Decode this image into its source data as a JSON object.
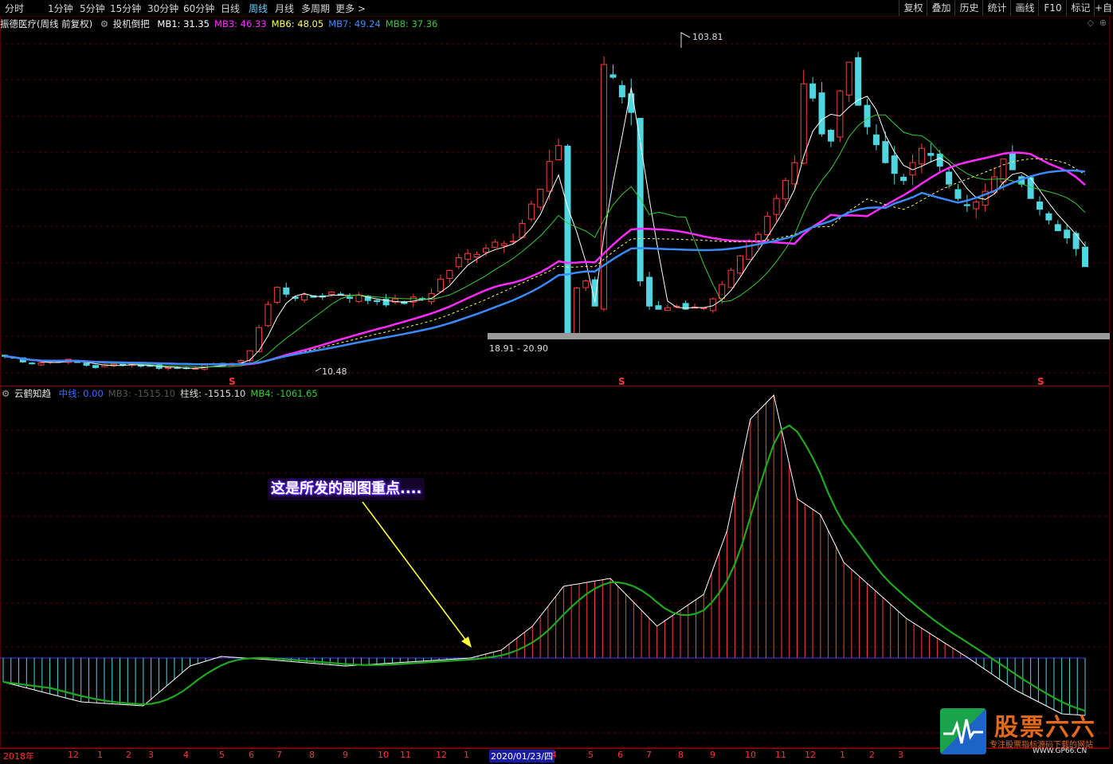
{
  "toolbar": {
    "periods": [
      "分时",
      "1分钟",
      "5分钟",
      "15分钟",
      "30分钟",
      "60分钟",
      "日线",
      "周线",
      "月线",
      "多周期",
      "更多 >"
    ],
    "active_period": "周线",
    "right_buttons": [
      "复权",
      "叠加",
      "历史",
      "统计",
      "画线",
      "F10",
      "标记",
      "+自选"
    ]
  },
  "main_panel": {
    "stock_title": "振德医疗(周线 前复权)",
    "indicator_name": "投机倒把",
    "lines": [
      {
        "label": "MB1: 31.35",
        "color": "#ffffff"
      },
      {
        "label": "MB3: 46.33",
        "color": "#ff2bff"
      },
      {
        "label": "MB6: 48.05",
        "color": "#ffff55"
      },
      {
        "label": "MB7: 49.24",
        "color": "#3a8bff"
      },
      {
        "label": "MB8: 37.36",
        "color": "#33cc33"
      }
    ],
    "high_label": "103.81",
    "low_label": "10.48",
    "band_label": "18.91 - 20.90",
    "signal_marker": "S"
  },
  "sub_panel": {
    "indicator_name": "云鹤知趋",
    "lines": [
      {
        "label": "中线: 0.00",
        "color": "#3a6cff"
      },
      {
        "label": "MB3: -1515.10",
        "color": "#555555"
      },
      {
        "label": "柱线: -1515.10",
        "color": "#dddddd"
      },
      {
        "label": "MB4: -1061.65",
        "color": "#33cc33"
      }
    ],
    "callout": "这是所发的副图重点...."
  },
  "date_axis": {
    "labels": [
      "2018年",
      "12",
      "1",
      "2",
      "3",
      "4",
      "5",
      "6",
      "7",
      "8",
      "9",
      "10",
      "11",
      "12",
      "1",
      "2020/01/23/四",
      "4",
      "5",
      "6",
      "7",
      "8",
      "9",
      "10",
      "11",
      "12",
      "1",
      "2",
      "3"
    ],
    "highlighted": "2020/01/23/四"
  },
  "watermark": {
    "brand": "股票六六",
    "tagline": "专注股票指标源码下载的网站",
    "site": "WWW.GP66.CN"
  },
  "colors": {
    "bull": "#ff3c3c",
    "bear": "#4fd6e0",
    "grid": "#5a0000",
    "ma_white": "#ffffff",
    "ma_green": "#33cc33",
    "ma_magenta": "#ff2bff",
    "ma_yellow": "#ffff55",
    "ma_blue": "#3a8bff",
    "band": "#9a9a9a"
  },
  "chart_data": [
    {
      "type": "candlestick",
      "title": "振德医疗(周线 前复权)",
      "period": "weekly",
      "annotated_high": 103.81,
      "annotated_low": 10.48,
      "support_band": [
        18.91,
        20.9
      ],
      "signals": [
        "S",
        "S",
        "S"
      ],
      "sample_closes": [
        14,
        12,
        13,
        11,
        12,
        11,
        10.5,
        11.5,
        12.5,
        33,
        30,
        32,
        30,
        29,
        30,
        40,
        45,
        48,
        62,
        88,
        96,
        82,
        70,
        63,
        72,
        62,
        66,
        70,
        60,
        57,
        52,
        50,
        48,
        45,
        44,
        37,
        30
      ]
    },
    {
      "type": "histogram",
      "title": "云鹤知趋",
      "series": [
        {
          "name": "中线",
          "value": 0.0
        },
        {
          "name": "MB3",
          "value": -1515.1
        },
        {
          "name": "柱线",
          "value": -1515.1
        },
        {
          "name": "MB4",
          "value": -1061.65
        }
      ]
    }
  ]
}
